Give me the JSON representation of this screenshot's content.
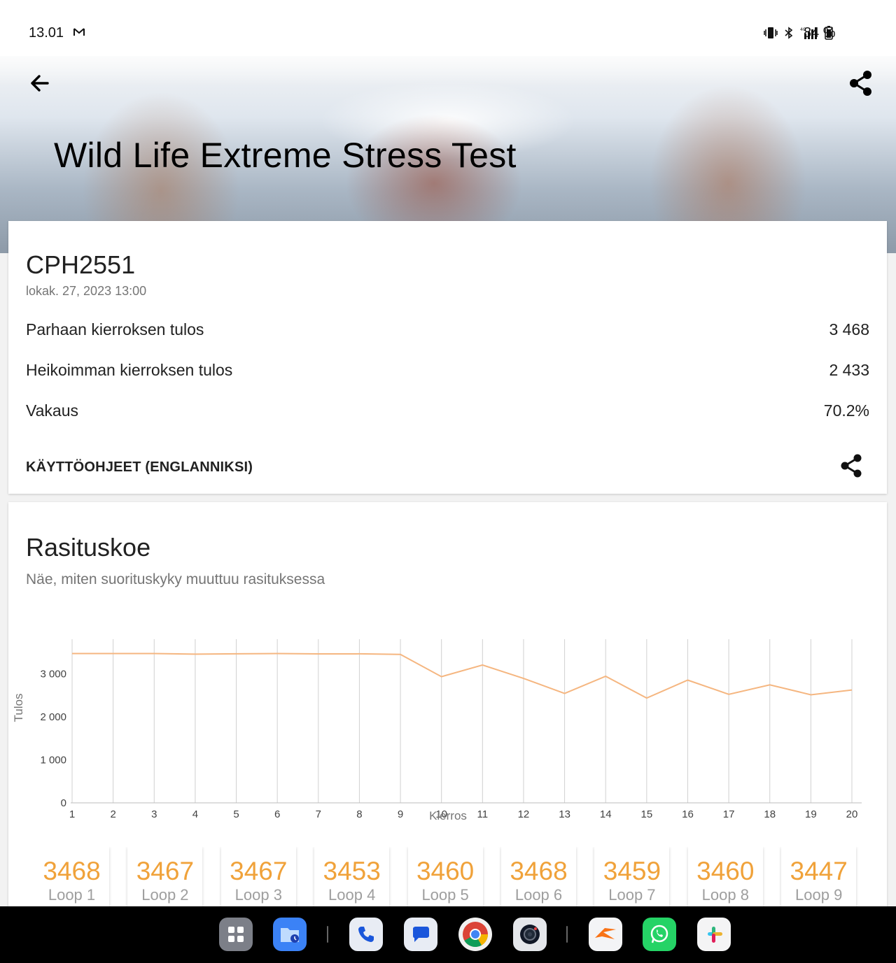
{
  "status_bar": {
    "time": "13.01",
    "battery": "84 %",
    "icons": [
      "gmail-icon",
      "vibrate-icon",
      "bluetooth-icon",
      "signal-4g-icon",
      "battery-icon"
    ]
  },
  "header": {
    "title": "Wild Life Extreme Stress Test",
    "back_icon": "arrow-back-icon",
    "share_icon": "share-icon"
  },
  "result": {
    "device": "CPH2551",
    "date": "lokak. 27, 2023 13:00",
    "rows": [
      {
        "label": "Parhaan kierroksen tulos",
        "value": "3 468"
      },
      {
        "label": "Heikoimman kierroksen tulos",
        "value": "2 433"
      },
      {
        "label": "Vakaus",
        "value": "70.2%"
      }
    ],
    "manual_link": "KÄYTTÖOHJEET (ENGLANNIKSI)"
  },
  "stress": {
    "title": "Rasituskoe",
    "subtitle": "Näe, miten suorituskyky muuttuu rasituksessa"
  },
  "chart_data": {
    "type": "line",
    "xlabel": "Kierros",
    "ylabel": "Tulos",
    "x": [
      1,
      2,
      3,
      4,
      5,
      6,
      7,
      8,
      9,
      10,
      11,
      12,
      13,
      14,
      15,
      16,
      17,
      18,
      19,
      20
    ],
    "values": [
      3468,
      3467,
      3467,
      3453,
      3460,
      3468,
      3459,
      3460,
      3447,
      2930,
      3200,
      2890,
      2540,
      2940,
      2433,
      2850,
      2520,
      2740,
      2510,
      2620
    ],
    "ylim": [
      0,
      3800
    ],
    "yticks": [
      0,
      1000,
      2000,
      3000
    ],
    "ytick_labels": [
      "0",
      "1 000",
      "2 000",
      "3 000"
    ],
    "line_color": "#f5b680",
    "grid": "vertical"
  },
  "loops": [
    {
      "value": "3468",
      "label": "Loop 1"
    },
    {
      "value": "3467",
      "label": "Loop 2"
    },
    {
      "value": "3467",
      "label": "Loop 3"
    },
    {
      "value": "3453",
      "label": "Loop 4"
    },
    {
      "value": "3460",
      "label": "Loop 5"
    },
    {
      "value": "3468",
      "label": "Loop 6"
    },
    {
      "value": "3459",
      "label": "Loop 7"
    },
    {
      "value": "3460",
      "label": "Loop 8"
    },
    {
      "value": "3447",
      "label": "Loop 9"
    }
  ],
  "dock": {
    "apps": [
      "app-drawer-icon",
      "files-icon",
      "phone-icon",
      "messages-icon",
      "chrome-icon",
      "camera-icon",
      "swiftkey-icon",
      "whatsapp-icon",
      "slack-icon"
    ]
  },
  "colors": {
    "accent": "#f0a23a",
    "line": "#f5b680"
  }
}
